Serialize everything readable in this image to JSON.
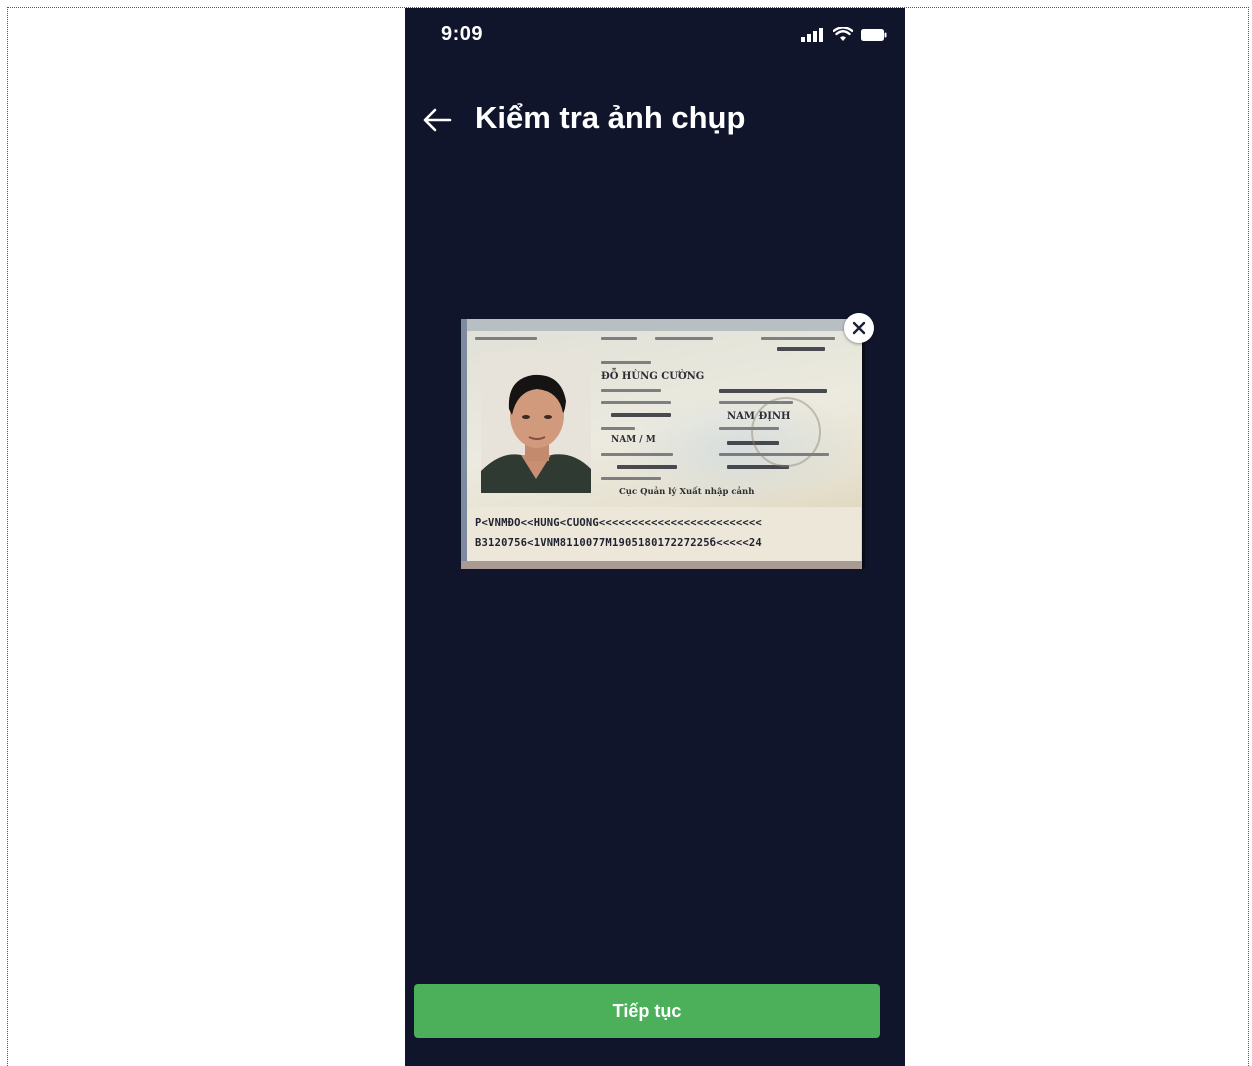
{
  "status_bar": {
    "time": "9:09",
    "icons": [
      "signal-icon",
      "wifi-icon",
      "battery-icon"
    ]
  },
  "header": {
    "back_icon": "arrow-left-icon",
    "title": "Kiểm tra ảnh chụp"
  },
  "captured_photo": {
    "description_icon": "passport-image",
    "remove_icon": "close-icon",
    "holder_name": "ĐỖ HÙNG CƯỜNG",
    "place_of_birth": "NAM ĐỊNH",
    "sex": "NAM / M",
    "issuing_authority": "Cục Quản lý Xuất nhập cảnh",
    "mrz_line_1": "P<VNMĐO<<HUNG<CUONG<<<<<<<<<<<<<<<<<<<<<<<<<",
    "mrz_line_2": "B3120756<1VNM8110077M190518017227225б<<<<<24"
  },
  "actions": {
    "continue_label": "Tiếp tục"
  },
  "colors": {
    "background": "#10152c",
    "primary": "#4caf5a",
    "text": "#ffffff"
  }
}
